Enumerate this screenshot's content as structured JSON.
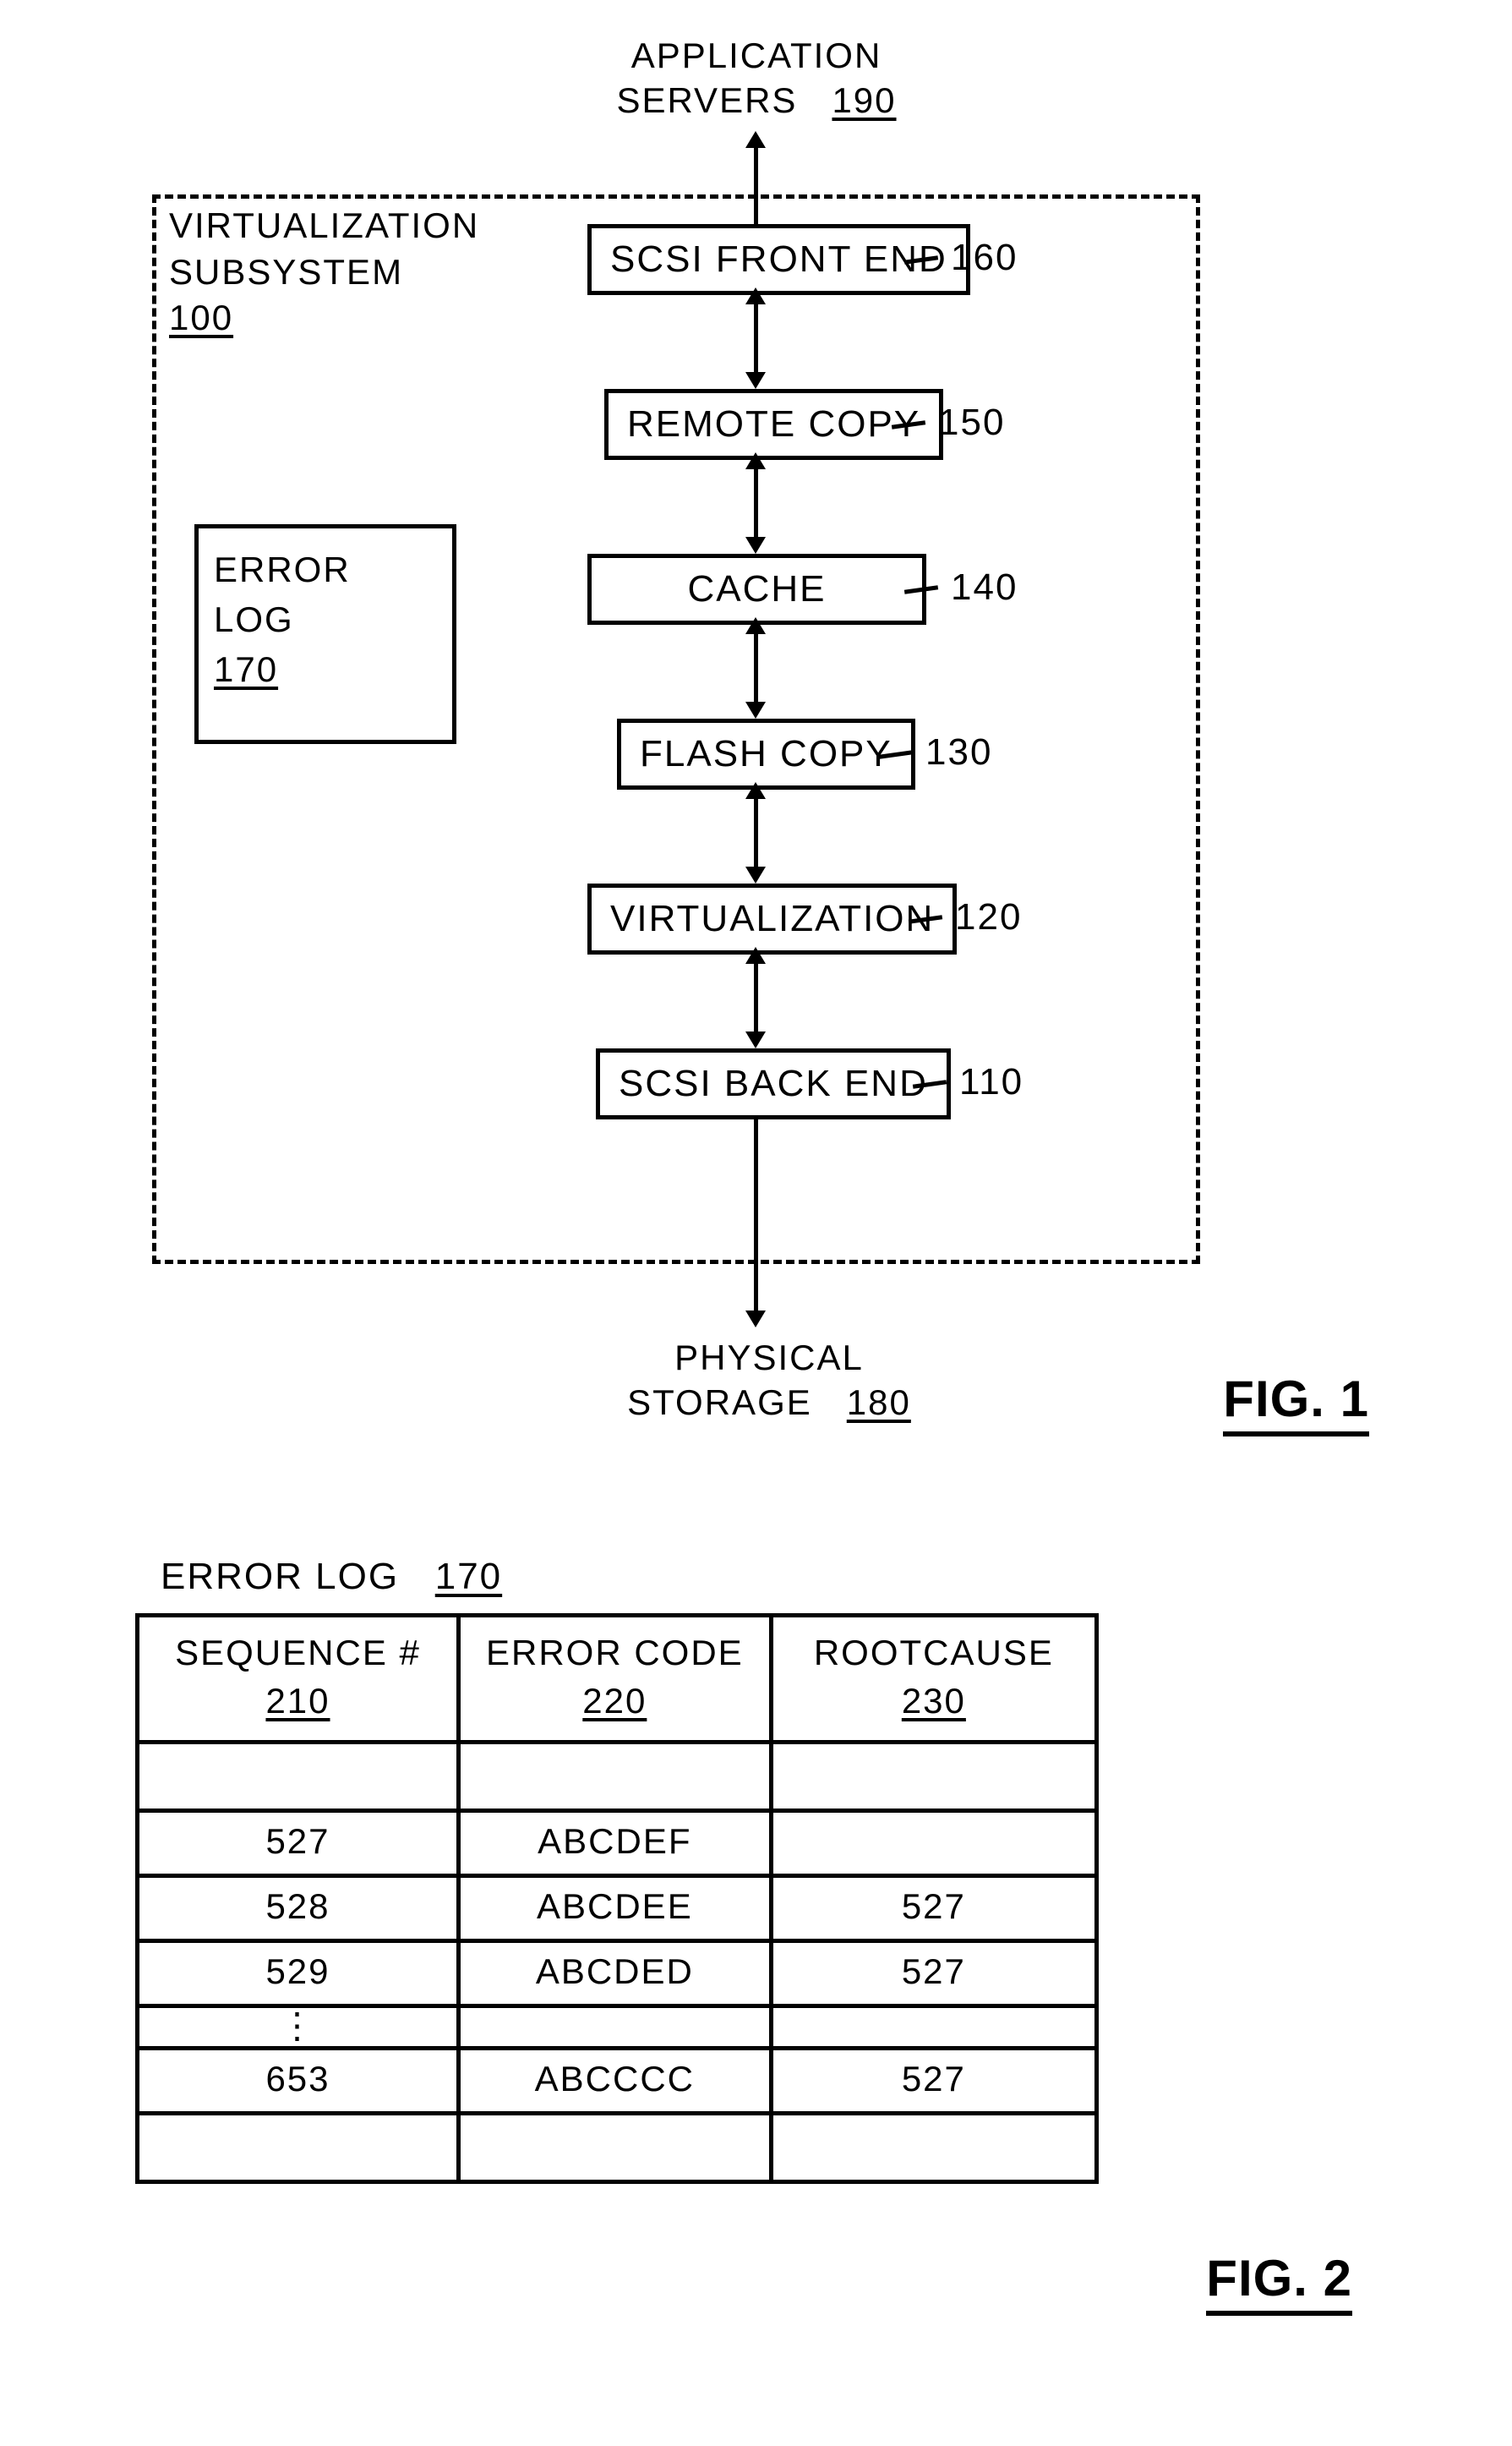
{
  "fig1": {
    "top_label_l1": "APPLICATION",
    "top_label_l2": "SERVERS",
    "top_ref": "190",
    "subsystem_label_l1": "VIRTUALIZATION",
    "subsystem_label_l2": "SUBSYSTEM",
    "subsystem_ref": "100",
    "error_log_label": "ERROR LOG",
    "error_log_ref": "170",
    "blocks": [
      {
        "label": "SCSI FRONT END",
        "ref": "160"
      },
      {
        "label": "REMOTE COPY",
        "ref": "150"
      },
      {
        "label": "CACHE",
        "ref": "140"
      },
      {
        "label": "FLASH COPY",
        "ref": "130"
      },
      {
        "label": "VIRTUALIZATION",
        "ref": "120"
      },
      {
        "label": "SCSI BACK END",
        "ref": "110"
      }
    ],
    "bottom_label_l1": "PHYSICAL",
    "bottom_label_l2": "STORAGE",
    "bottom_ref": "180",
    "fig_label": "FIG. 1"
  },
  "fig2": {
    "title": "ERROR LOG",
    "title_ref": "170",
    "headers": {
      "seq": "SEQUENCE #",
      "seq_ref": "210",
      "err": "ERROR CODE",
      "err_ref": "220",
      "root": "ROOTCAUSE",
      "root_ref": "230"
    },
    "rows": [
      {
        "seq": "",
        "err": "",
        "root": ""
      },
      {
        "seq": "527",
        "err": "ABCDEF",
        "root": ""
      },
      {
        "seq": "528",
        "err": "ABCDEE",
        "root": "527"
      },
      {
        "seq": "529",
        "err": "ABCDED",
        "root": "527"
      },
      {
        "seq": "⋮",
        "err": "",
        "root": ""
      },
      {
        "seq": "653",
        "err": "ABCCCC",
        "root": "527"
      },
      {
        "seq": "",
        "err": "",
        "root": ""
      }
    ],
    "fig_label": "FIG. 2"
  }
}
